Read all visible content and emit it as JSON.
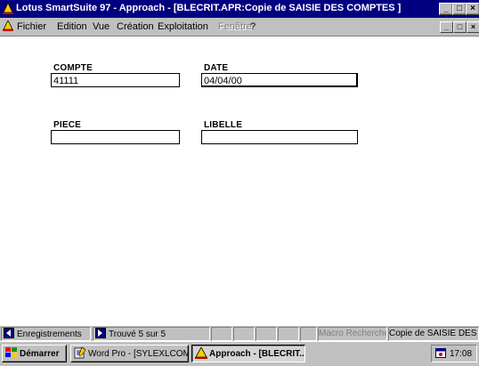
{
  "window": {
    "title": "Lotus SmartSuite 97   - Approach - [BLECRIT.APR:Copie de SAISIE DES COMPTES ]",
    "min_label": "_",
    "max_label": "□",
    "close_label": "×"
  },
  "menu": {
    "items": [
      "Fichier",
      "Edition",
      "Vue",
      "Création",
      "Exploitation"
    ],
    "disabled_items": [
      "Fenêtre"
    ],
    "help": "?"
  },
  "form": {
    "fields": [
      {
        "label": "COMPTE",
        "value": "41111"
      },
      {
        "label": "DATE",
        "value": "04/04/00"
      },
      {
        "label": "PIECE",
        "value": ""
      },
      {
        "label": "LIBELLE",
        "value": ""
      }
    ]
  },
  "statusbar": {
    "view": "Enregistrements",
    "records": "Trouvé 5 sur 5",
    "macro": "Macro Recherche",
    "form_name": "Copie de SAISIE DES CO"
  },
  "taskbar": {
    "start": "Démarrer",
    "tasks": [
      "Word Pro - [SYLEXLCOM...",
      "Approach - [BLECRIT..."
    ],
    "clock": "17:08"
  },
  "colors": {
    "titlebar": "#000080",
    "chrome": "#c0c0c0",
    "form_bg": "#ffffff"
  }
}
